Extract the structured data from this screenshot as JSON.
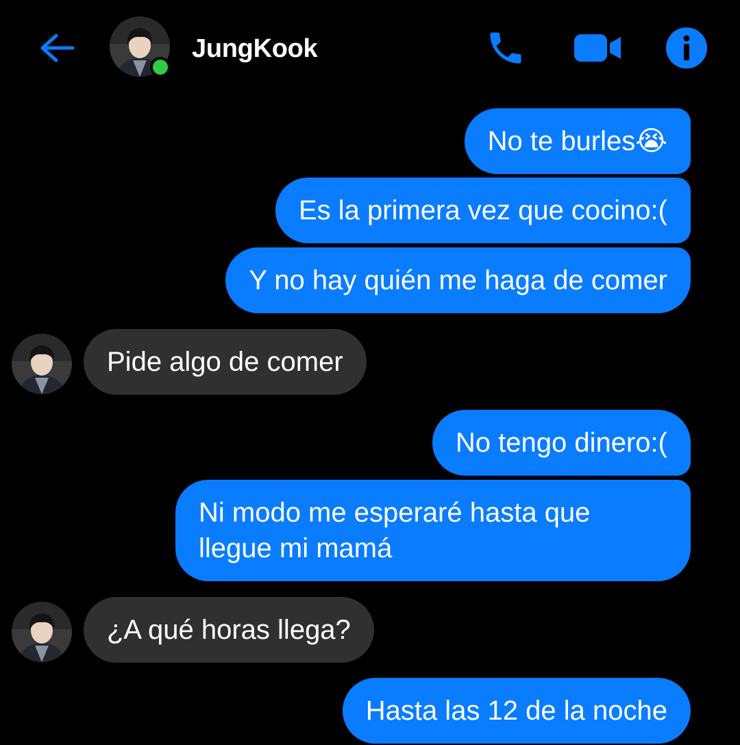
{
  "header": {
    "contact_name": "JungKook",
    "back_icon": "arrow-left-icon",
    "actions": [
      "phone-icon",
      "video-camera-icon",
      "info-icon"
    ],
    "status": "online"
  },
  "messages": [
    {
      "from": "me",
      "text": "No te burles😭"
    },
    {
      "from": "me",
      "text": "Es la primera vez que cocino:("
    },
    {
      "from": "me",
      "text": "Y no hay quién me haga de comer"
    },
    {
      "from": "them",
      "text": "Pide algo de comer"
    },
    {
      "from": "me",
      "text": "No tengo dinero:("
    },
    {
      "from": "me",
      "lines": [
        "Ni modo me esperaré hasta que",
        "llegue mi mamá"
      ]
    },
    {
      "from": "them",
      "text": "¿A qué horas llega?"
    },
    {
      "from": "me",
      "text": "Hasta las 12 de la noche"
    }
  ],
  "colors": {
    "accent": "#0a7cff",
    "outgoing_bubble": "#0a7cff",
    "incoming_bubble": "#303030",
    "background": "#000000",
    "online": "#31cc46"
  }
}
